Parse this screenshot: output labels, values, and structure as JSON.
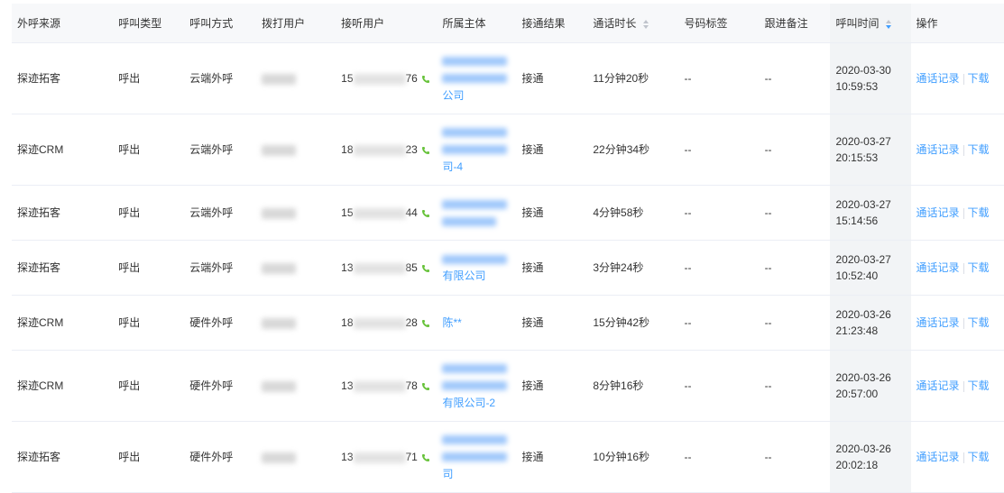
{
  "table": {
    "headers": {
      "source": "外呼来源",
      "call_type": "呼叫类型",
      "call_method": "呼叫方式",
      "caller": "拨打用户",
      "callee": "接听用户",
      "entity": "所属主体",
      "result": "接通结果",
      "duration": "通话时长",
      "tag": "号码标签",
      "remark": "跟进备注",
      "time": "呼叫时间",
      "actions": "操作"
    },
    "sort": {
      "time": "desc",
      "duration": "none"
    },
    "rows": [
      {
        "source": "探迹拓客",
        "call_type": "呼出",
        "call_method": "云端外呼",
        "callee_prefix": "15",
        "callee_suffix": "76",
        "entity_tail": "公司",
        "result": "接通",
        "duration": "11分钟20秒",
        "tag": "--",
        "remark": "--",
        "date": "2020-03-30",
        "clock": "10:59:53"
      },
      {
        "source": "探迹CRM",
        "call_type": "呼出",
        "call_method": "云端外呼",
        "callee_prefix": "18",
        "callee_suffix": "23",
        "entity_tail": "司-4",
        "result": "接通",
        "duration": "22分钟34秒",
        "tag": "--",
        "remark": "--",
        "date": "2020-03-27",
        "clock": "20:15:53"
      },
      {
        "source": "探迹拓客",
        "call_type": "呼出",
        "call_method": "云端外呼",
        "callee_prefix": "15",
        "callee_suffix": "44",
        "entity_tail": "",
        "result": "接通",
        "duration": "4分钟58秒",
        "tag": "--",
        "remark": "--",
        "date": "2020-03-27",
        "clock": "15:14:56"
      },
      {
        "source": "探迹拓客",
        "call_type": "呼出",
        "call_method": "云端外呼",
        "callee_prefix": "13",
        "callee_suffix": "85",
        "entity_tail": "有限公司",
        "result": "接通",
        "duration": "3分钟24秒",
        "tag": "--",
        "remark": "--",
        "date": "2020-03-27",
        "clock": "10:52:40"
      },
      {
        "source": "探迹CRM",
        "call_type": "呼出",
        "call_method": "硬件外呼",
        "callee_prefix": "18",
        "callee_suffix": "28",
        "entity_tail": "陈**",
        "result": "接通",
        "duration": "15分钟42秒",
        "tag": "--",
        "remark": "--",
        "date": "2020-03-26",
        "clock": "21:23:48"
      },
      {
        "source": "探迹CRM",
        "call_type": "呼出",
        "call_method": "硬件外呼",
        "callee_prefix": "13",
        "callee_suffix": "78",
        "entity_tail": "有限公司-2",
        "result": "接通",
        "duration": "8分钟16秒",
        "tag": "--",
        "remark": "--",
        "date": "2020-03-26",
        "clock": "20:57:00"
      },
      {
        "source": "探迹拓客",
        "call_type": "呼出",
        "call_method": "硬件外呼",
        "callee_prefix": "13",
        "callee_suffix": "71",
        "entity_tail": "司",
        "result": "接通",
        "duration": "10分钟16秒",
        "tag": "--",
        "remark": "--",
        "date": "2020-03-26",
        "clock": "20:02:18"
      }
    ],
    "actions": {
      "record_label": "通话记录",
      "download_label": "下载"
    },
    "icons": {
      "phone": "phone-icon",
      "sort": "sort-icon"
    },
    "colors": {
      "link": "#409eff",
      "phone": "#67c23a",
      "header_bg": "#f7f8fa",
      "border": "#ebeef5"
    }
  }
}
